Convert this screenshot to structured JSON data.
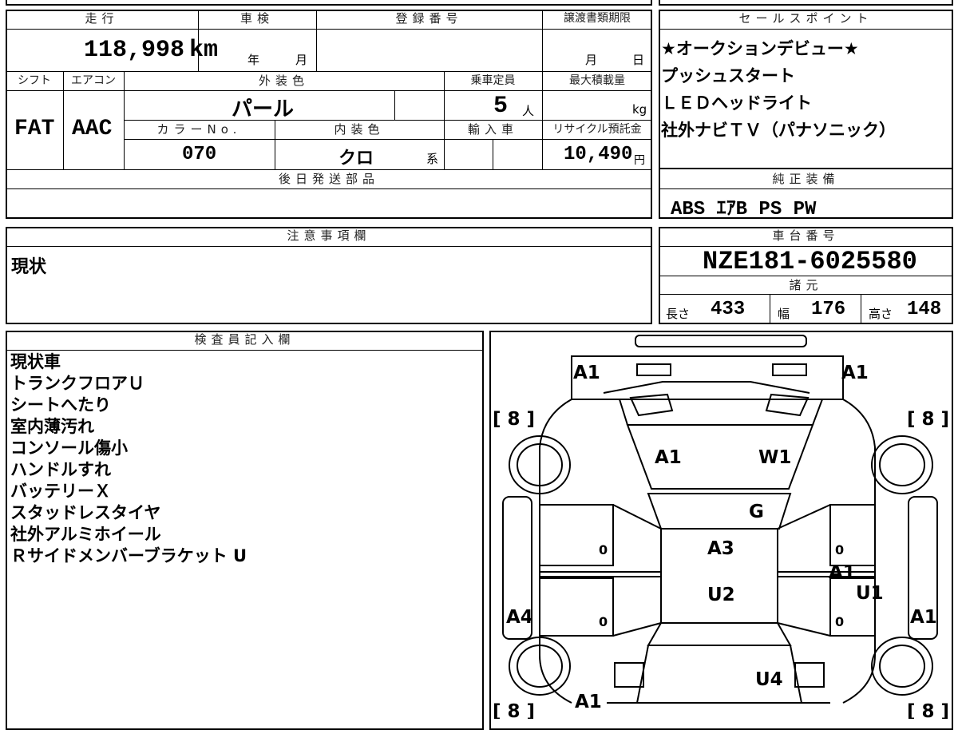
{
  "header": {
    "mileage_label": "走行",
    "shaken_label": "車検",
    "registration_label": "登録番号",
    "transfer_deadline_label": "譲渡書類期限",
    "sales_points_label": "セールスポイント"
  },
  "mileage": {
    "value": "118,998",
    "unit": "km"
  },
  "shaken": {
    "year_label": "年",
    "month_label": "月"
  },
  "transfer": {
    "month_label": "月",
    "day_label": "日"
  },
  "row2_labels": {
    "shift": "シフト",
    "aircon": "エアコン",
    "exterior_color": "外装色",
    "capacity": "乗車定員",
    "max_load": "最大積載量"
  },
  "shift": "FAT",
  "aircon": "AAC",
  "exterior_color": "パール",
  "capacity": {
    "value": "5",
    "unit": "人"
  },
  "max_load": {
    "unit": "kg"
  },
  "row3_labels": {
    "color_no": "カラーNo.",
    "interior_color": "内装色",
    "import": "輸入車",
    "recycle": "リサイクル預託金"
  },
  "color_no": "070",
  "interior_color": {
    "value": "クロ",
    "suffix": "系"
  },
  "recycle": {
    "value": "10,490",
    "unit": "円"
  },
  "later_parts_label": "後日発送部品",
  "sales_points": [
    "★オークションデビュー★",
    "プッシュスタート",
    "ＬＥＤヘッドライト",
    "社外ナビＴＶ（パナソニック）"
  ],
  "genuine_equipment_label": "純正装備",
  "genuine_equipment": "ABS ｴｱB PS PW",
  "notes_label": "注意事項欄",
  "notes_text": "現状",
  "chassis_label": "車台番号",
  "chassis_number": "NZE181-6025580",
  "specs_label": "諸元",
  "specs": {
    "length_label": "長さ",
    "length": "433",
    "width_label": "幅",
    "width": "176",
    "height_label": "高さ",
    "height": "148"
  },
  "inspector_label": "検査員記入欄",
  "inspector_notes": [
    "現状車",
    "トランクフロアＵ",
    "シートへたり",
    "室内薄汚れ",
    "コンソール傷小",
    "ハンドルすれ",
    "バッテリーＸ",
    "スタッドレスタイヤ",
    "社外アルミホイール",
    "Ｒサイドメンバーブラケット U"
  ],
  "diagram": {
    "tread_fl": "[ 8 ]",
    "tread_fr": "[ 8 ]",
    "tread_rl": "[ 8 ]",
    "tread_rr": "[ 8 ]",
    "front_left_corner": "A1",
    "front_right_corner": "A1",
    "hood_left": "A1",
    "hood_right": "W1",
    "windshield": "G",
    "roof_front": "A3",
    "roof_rear": "U2",
    "right_door_front": "A1",
    "right_door_rear": "U1",
    "left_rear_side": "A4",
    "right_rear_side": "A1",
    "trunk": "U4",
    "rear_left": "A1",
    "door_fl_mark": "0",
    "door_rl_mark": "0",
    "door_fr_mark": "0",
    "door_rr_mark": "0"
  }
}
